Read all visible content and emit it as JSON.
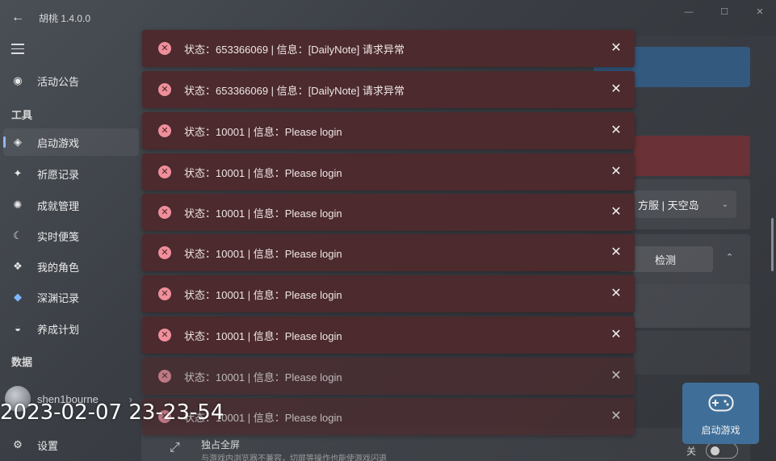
{
  "app": {
    "title": "胡桃 1.4.0.0"
  },
  "sidebar": {
    "top_item": {
      "label": "活动公告",
      "icon": "announcement-icon"
    },
    "section_tools": "工具",
    "items": [
      {
        "label": "启动游戏",
        "icon": "launch-icon",
        "active": true
      },
      {
        "label": "祈愿记录",
        "icon": "wish-icon"
      },
      {
        "label": "成就管理",
        "icon": "achievement-icon"
      },
      {
        "label": "实时便笺",
        "icon": "moon-icon"
      },
      {
        "label": "我的角色",
        "icon": "character-icon"
      },
      {
        "label": "深渊记录",
        "icon": "abyss-icon"
      },
      {
        "label": "养成计划",
        "icon": "cultivation-icon"
      }
    ],
    "section_data": "数据",
    "user": {
      "name": "shen1bourne"
    },
    "settings": {
      "label": "设置",
      "icon": "gear-icon"
    }
  },
  "main": {
    "server_select": "方服 | 天空岛",
    "detect_button": "检测",
    "fullscreen": {
      "title": "独占全屏",
      "desc": "与游戏内浏览器不兼容，切屏等操作也能使游戏闪退"
    },
    "toggle_label": "关",
    "launch_button": "启动游戏"
  },
  "toasts": [
    {
      "message": "状态：653366069 | 信息：[DailyNote] 请求异常"
    },
    {
      "message": "状态：653366069 | 信息：[DailyNote] 请求异常"
    },
    {
      "message": "状态：10001 | 信息：Please login"
    },
    {
      "message": "状态：10001 | 信息：Please login"
    },
    {
      "message": "状态：10001 | 信息：Please login"
    },
    {
      "message": "状态：10001 | 信息：Please login"
    },
    {
      "message": "状态：10001 | 信息：Please login"
    },
    {
      "message": "状态：10001 | 信息：Please login"
    },
    {
      "message": "状态：10001 | 信息：Please login"
    },
    {
      "message": "状态：10001 | 信息：Please login"
    }
  ],
  "overlay_timestamp": "2023-02-07 23-23-54",
  "colors": {
    "toast_bg": "#4c2a2d",
    "error_icon": "#ef8f9b",
    "accent_blue": "#3f6f99"
  }
}
